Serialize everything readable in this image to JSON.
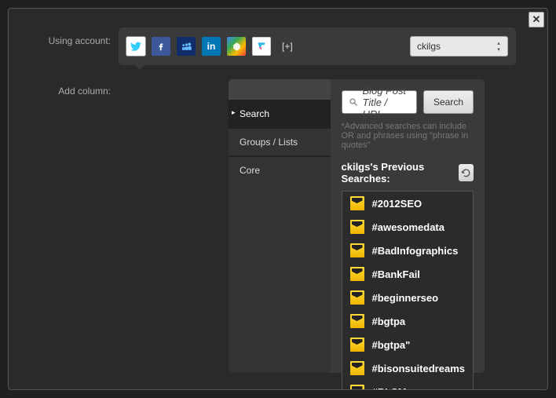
{
  "labels": {
    "using_account": "Using account:",
    "add_column": "Add column:"
  },
  "plus": "[+]",
  "account_value": "ckilgs",
  "tabs": {
    "search": "Search",
    "groups": "Groups / Lists",
    "core": "Core"
  },
  "search": {
    "placeholder": "Blog Post Title / URL",
    "button": "Search",
    "hint": "*Advanced searches can include OR and phrases using \"phrase in quotes\""
  },
  "previous": {
    "title": "ckilgs's Previous Searches:",
    "items": [
      "#2012SEO",
      "#awesomedata",
      "#BadInfographics",
      "#BankFail",
      "#beginnerseo",
      "#bgtpa",
      "#bgtpa\"",
      "#bisonsuitedreams",
      "#BLSM"
    ]
  }
}
